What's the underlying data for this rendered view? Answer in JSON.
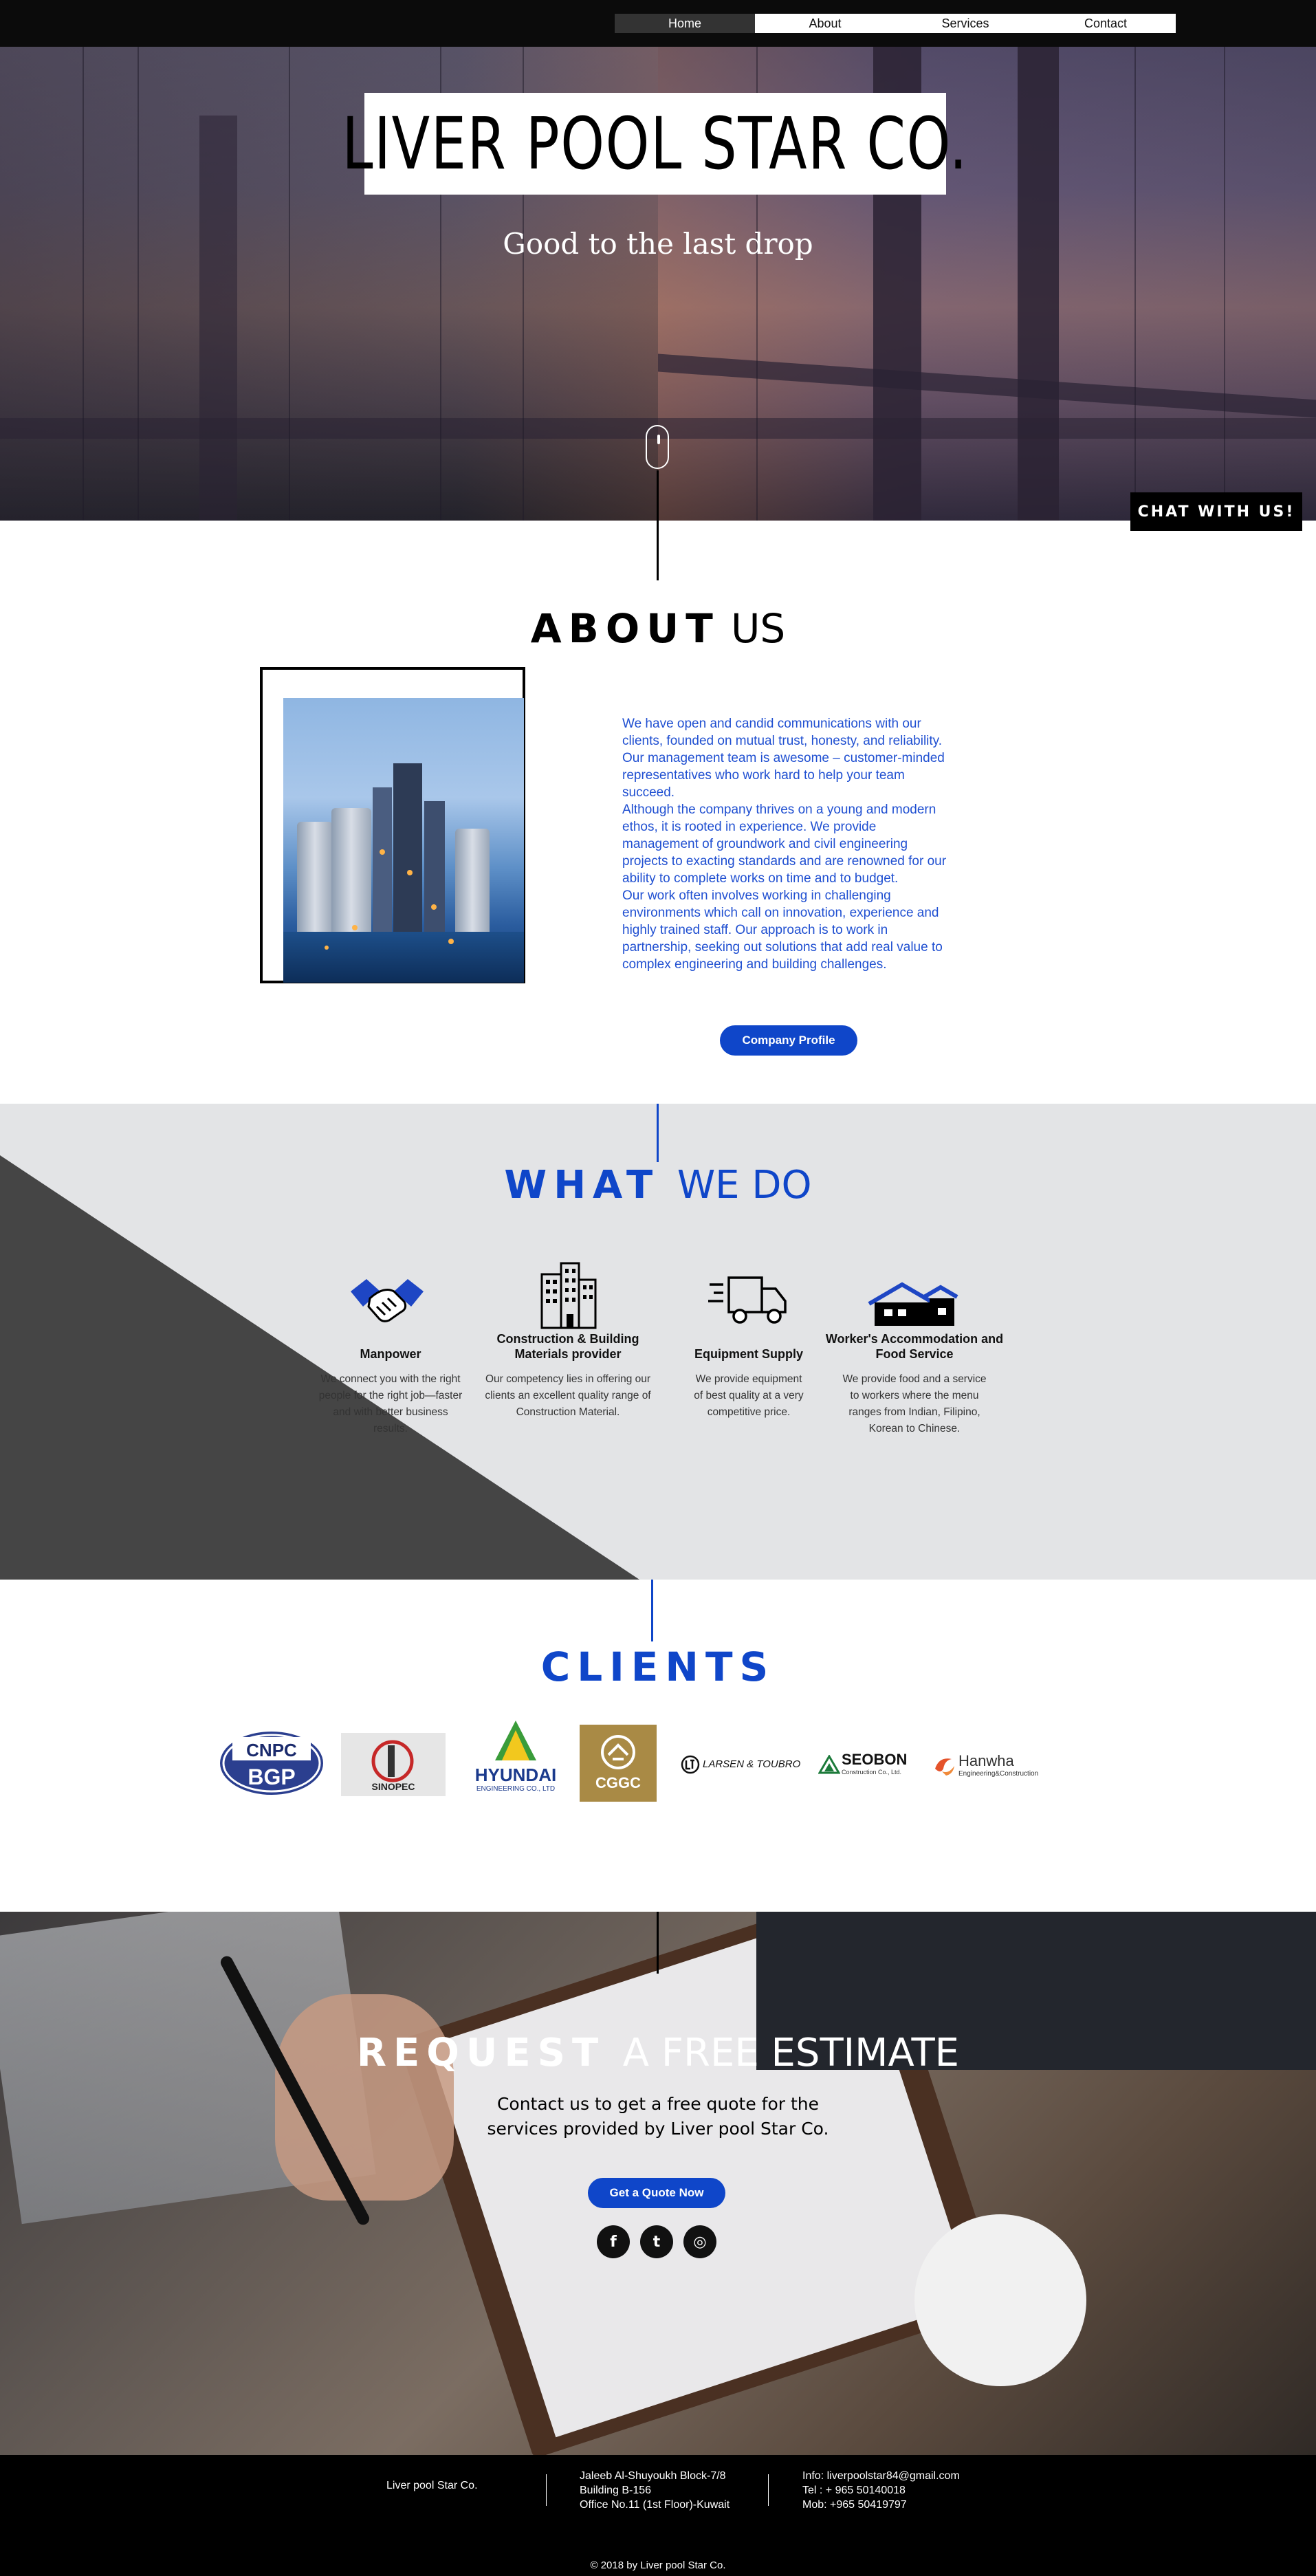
{
  "nav": {
    "items": [
      {
        "label": "Home",
        "active": true
      },
      {
        "label": "About",
        "active": false
      },
      {
        "label": "Services",
        "active": false
      },
      {
        "label": "Contact",
        "active": false
      }
    ]
  },
  "hero": {
    "title": "LIVER POOL STAR CO.",
    "tagline": "Good to the last drop",
    "chat_label": "CHAT WITH US!"
  },
  "about": {
    "heading_bold": "ABOUT",
    "heading_thin": "US",
    "paragraphs": [
      "We have open and candid communications with our clients, founded on mutual trust, honesty, and reliability. Our management team is awesome – customer-minded representatives who work hard to help your team succeed.",
      "Although the company thrives on a young and modern ethos, it is rooted in experience. We provide management of groundwork and civil engineering projects to exacting standards and are renowned for our ability to complete works on time and to budget.",
      "Our work often involves working in challenging environments which call on innovation, experience and highly trained staff.   Our approach is to work in partnership, seeking out solutions that add real value to complex engineering and building challenges."
    ],
    "button_label": "Company Profile"
  },
  "services": {
    "heading_bold": "WHAT",
    "heading_thin": "WE DO",
    "items": [
      {
        "icon": "handshake-icon",
        "title": "Manpower",
        "desc": "We connect you with the right people for the right job—faster and with better business results."
      },
      {
        "icon": "buildings-icon",
        "title": "Construction & Building Materials provider",
        "desc": "Our competency lies in offering our clients an excellent quality range of Construction Material."
      },
      {
        "icon": "delivery-truck-icon",
        "title": "Equipment Supply",
        "desc": "We provide equipment of best quality at a very competitive price."
      },
      {
        "icon": "house-icon",
        "title": "Worker's Accommodation and Food Service",
        "desc": "We provide food and a service to workers where the menu ranges from Indian, Filipino, Korean to Chinese."
      }
    ]
  },
  "clients": {
    "heading": "CLIENTS",
    "logos": [
      {
        "name": "CNPC BGP",
        "line1": "CNPC",
        "line2": "BGP"
      },
      {
        "name": "SINOPEC",
        "line1": "SINOPEC"
      },
      {
        "name": "HYUNDAI",
        "line1": "HYUNDAI",
        "line2": "ENGINEERING CO., LTD"
      },
      {
        "name": "CGGC",
        "line1": "CGGC"
      },
      {
        "name": "LARSEN & TOUBRO",
        "line1": "LARSEN & TOUBRO"
      },
      {
        "name": "SEOBON",
        "line1": "SEOBON",
        "line2": "Construction Co., Ltd."
      },
      {
        "name": "Hanwha",
        "line1": "Hanwha",
        "line2": "Engineering&Construction"
      }
    ]
  },
  "request": {
    "heading_bold": "REQUEST",
    "heading_thin": "A FREE ESTIMATE",
    "line1": "Contact us to get a free quote for the",
    "line2": "services provided by Liver pool Star Co.",
    "button_label": "Get a Quote Now",
    "social": [
      {
        "icon": "facebook-icon",
        "glyph": "f"
      },
      {
        "icon": "twitter-icon",
        "glyph": "t"
      },
      {
        "icon": "instagram-icon",
        "glyph": "◎"
      }
    ]
  },
  "footer": {
    "company": "Liver pool Star Co.",
    "address": [
      "Jaleeb Al-Shuyoukh Block-7/8",
      "Building B-156",
      "Office No.11 (1st Floor)-Kuwait"
    ],
    "contact": [
      "Info: liverpoolstar84@gmail.com",
      "Tel  : + 965 50140018",
      "Mob: +965 50419797"
    ],
    "copyright": "© 2018 by Liver pool Star Co."
  },
  "colors": {
    "accent_blue": "#0f46c9",
    "text_blue": "#1f4fd1",
    "nav_active": "#333333",
    "footer_bg": "#000000",
    "section_gray": "#e3e4e6"
  }
}
